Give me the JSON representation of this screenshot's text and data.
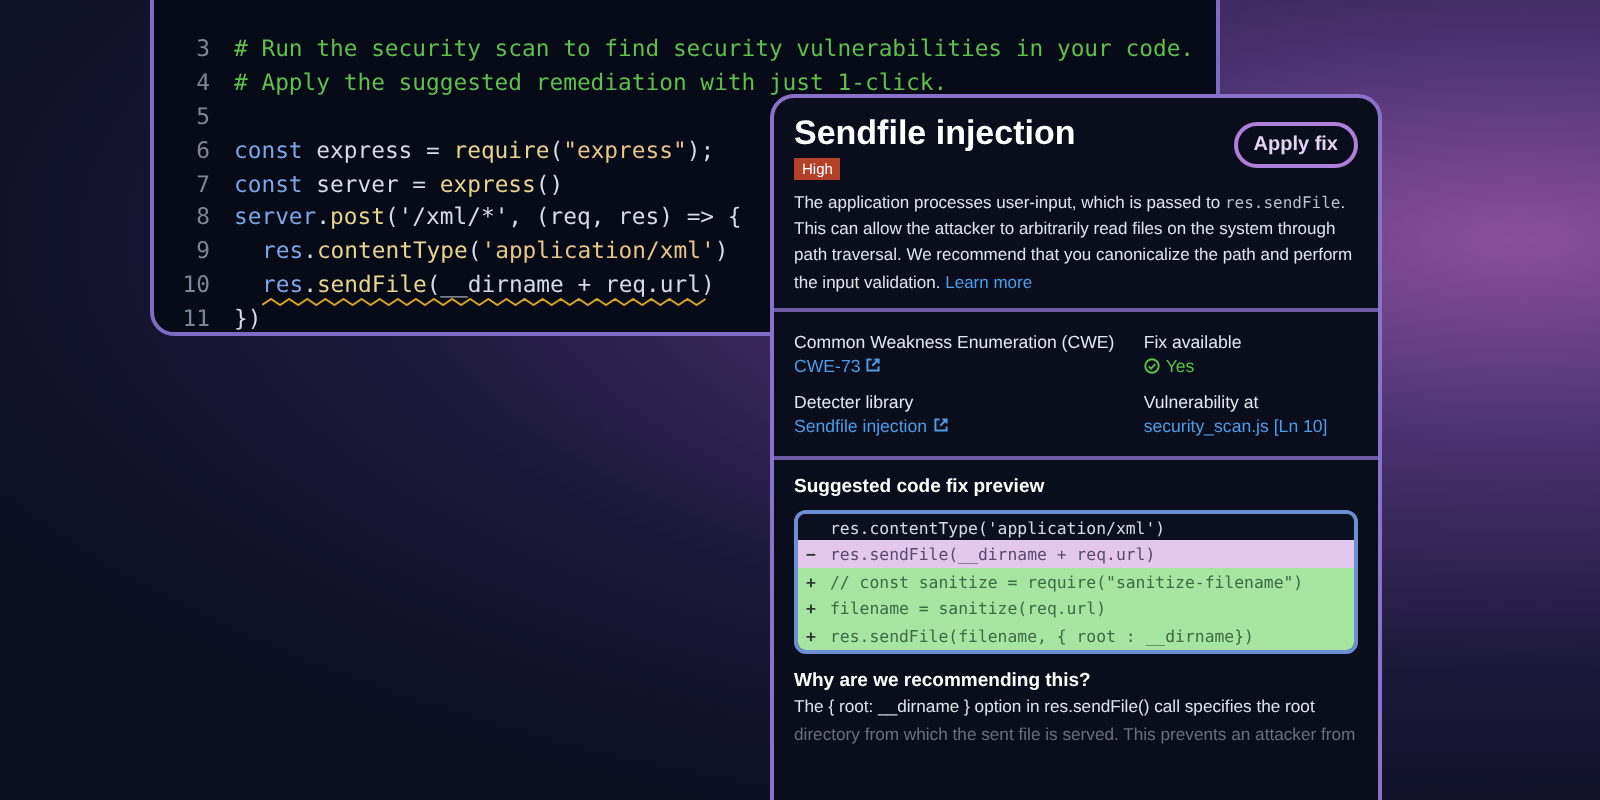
{
  "editor": {
    "lines": [
      {
        "number": "3",
        "segments": [
          {
            "kind": "comment",
            "text": "# Run the security scan to find security vulnerabilities in your code."
          }
        ]
      },
      {
        "number": "4",
        "segments": [
          {
            "kind": "comment",
            "text": "# Apply the suggested remediation with just 1-click."
          }
        ]
      },
      {
        "number": "5"
      },
      {
        "number": "6",
        "segments": [
          {
            "kind": "keyword",
            "text": "const "
          },
          {
            "kind": "plain",
            "text": "express = "
          },
          {
            "kind": "method",
            "text": "require"
          },
          {
            "kind": "plain",
            "text": "("
          },
          {
            "kind": "string",
            "text": "\"express\""
          },
          {
            "kind": "plain",
            "text": ");"
          }
        ]
      },
      {
        "number": "7",
        "segments": [
          {
            "kind": "keyword",
            "text": "const "
          },
          {
            "kind": "plain",
            "text": "server = "
          },
          {
            "kind": "method",
            "text": "express"
          },
          {
            "kind": "plain",
            "text": "()"
          }
        ]
      },
      {
        "number": "8",
        "segments": [
          {
            "kind": "keyword",
            "text": "server"
          },
          {
            "kind": "plain",
            "text": "."
          },
          {
            "kind": "method",
            "text": "post"
          },
          {
            "kind": "plain",
            "text": "('/xml/*', (req, res) => {"
          }
        ]
      },
      {
        "number": "9",
        "indented": true,
        "segments": [
          {
            "kind": "keyword",
            "text": "res"
          },
          {
            "kind": "plain",
            "text": "."
          },
          {
            "kind": "method",
            "text": "contentType"
          },
          {
            "kind": "plain",
            "text": "("
          },
          {
            "kind": "string",
            "text": "'application/xml'"
          },
          {
            "kind": "plain",
            "text": ")"
          }
        ]
      },
      {
        "number": "10",
        "indented": true,
        "flagged": true,
        "segments": [
          {
            "kind": "keyword",
            "text": "res"
          },
          {
            "kind": "plain",
            "text": "."
          },
          {
            "kind": "method",
            "text": "sendFile"
          },
          {
            "kind": "plain",
            "text": "(__dirname + req.url)"
          }
        ]
      },
      {
        "number": "11",
        "segments": [
          {
            "kind": "plain",
            "text": "})"
          }
        ]
      }
    ]
  },
  "finding": {
    "title": "Sendfile injection",
    "severity": "High",
    "action": "Apply fix",
    "description": "The application processes user-input, which is passed to ",
    "description_code": "res.sendFile",
    "description_rest": ". This can allow the attacker to arbitrarily read files on the system through path traversal. We recommend that you canonicalize the path and perform the input validation.",
    "learn_more": "Learn more",
    "details": [
      {
        "kind": "link",
        "label": "Common Weakness Enumeration (CWE)",
        "value": "CWE-73"
      },
      {
        "kind": "status",
        "label": "Fix available",
        "value": "Yes"
      },
      {
        "kind": "link",
        "label": "Detecter library",
        "value": "Sendfile injection"
      },
      {
        "kind": "plain_link",
        "label": "Vulnerability at",
        "value": "security_scan.js [Ln 10]"
      }
    ],
    "preview_title": "Suggested code fix preview",
    "diff": [
      {
        "kind": "context",
        "code": "res.contentType('application/xml')"
      },
      {
        "kind": "removed",
        "sign": "−",
        "code": "res.sendFile(__dirname + req.url)"
      },
      {
        "kind": "added",
        "sign": "+",
        "code": "// const sanitize = require(\"sanitize-filename\")"
      },
      {
        "kind": "added",
        "sign": "+",
        "code": "filename = sanitize(req.url)"
      },
      {
        "kind": "added",
        "sign": "+",
        "code": "res.sendFile(filename, { root : __dirname})"
      }
    ],
    "why_title": "Why are we recommending this?",
    "why_lines": [
      "The { root: __dirname } option in res.sendFile() call specifies the root",
      "directory from which the sent file is served. This prevents an attacker from"
    ]
  }
}
